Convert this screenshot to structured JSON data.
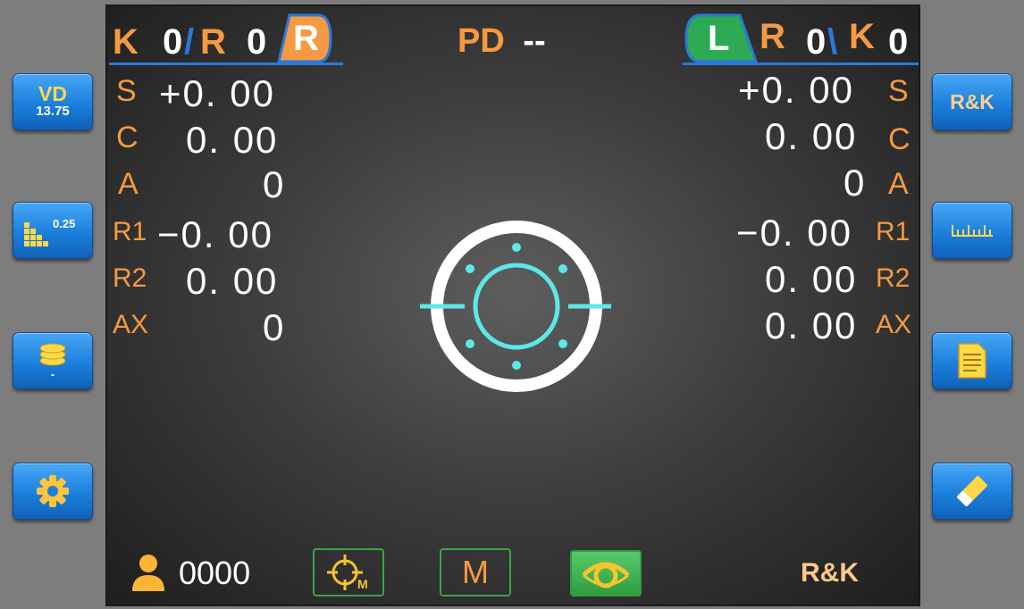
{
  "header": {
    "left_k_label": "K",
    "left_k_value": "0",
    "left_slash": "/",
    "left_r_label": "R",
    "left_r_value": "0",
    "right_eye_tab": "R",
    "pd_label": "PD",
    "pd_value": "--",
    "left_eye_tab": "L",
    "right_r_label": "R",
    "right_r_value": "0",
    "right_slash": "\\",
    "right_k_label": "K",
    "right_k_value": "0"
  },
  "right_eye": {
    "rows": [
      {
        "label": "S",
        "value": "+0. 00"
      },
      {
        "label": "C",
        "value": "0. 00"
      },
      {
        "label": "A",
        "value": "0"
      },
      {
        "label": "R1",
        "value": "−0. 00"
      },
      {
        "label": "R2",
        "value": "0. 00"
      },
      {
        "label": "AX",
        "value": "0"
      }
    ]
  },
  "left_eye": {
    "rows": [
      {
        "label": "S",
        "value": "+0. 00"
      },
      {
        "label": "C",
        "value": "0. 00"
      },
      {
        "label": "A",
        "value": "0"
      },
      {
        "label": "R1",
        "value": "−0. 00"
      },
      {
        "label": "R2",
        "value": "0. 00"
      },
      {
        "label": "AX",
        "value": "0. 00"
      }
    ]
  },
  "left_buttons": {
    "vd_label": "VD",
    "vd_value": "13.75",
    "step_value": "0.25",
    "database_value": "-",
    "settings_icon": "gear-icon"
  },
  "right_buttons": {
    "rk_label": "R&K",
    "ruler_icon": "ruler-icon",
    "report_icon": "document-icon",
    "clear_icon": "eraser-icon"
  },
  "bottom": {
    "patient_id": "0000",
    "auto_mode_icon": "crosshair-m-icon",
    "manual_label": "M",
    "eye_icon": "eye-tracking-icon",
    "mode_label": "R&K"
  },
  "colors": {
    "accent_orange": "#f59a42",
    "accent_blue": "#2b79d8",
    "accent_green": "#3aa54a",
    "target_cyan": "#5ee7e7"
  }
}
